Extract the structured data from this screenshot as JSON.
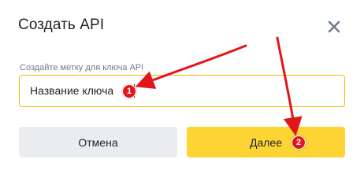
{
  "dialog": {
    "title": "Создать API",
    "close_icon": "close-icon"
  },
  "form": {
    "label": "Создайте метку для ключа API",
    "input_value": "Название ключа"
  },
  "buttons": {
    "cancel_label": "Отмена",
    "next_label": "Далее"
  },
  "annotations": {
    "badge_1": "1",
    "badge_2": "2",
    "arrow_color": "#e0161b"
  },
  "colors": {
    "accent": "#fcd535",
    "input_border": "#f0b90b",
    "secondary_button": "#eaecef",
    "text": "#1e2329",
    "muted_text": "#707a8a"
  }
}
